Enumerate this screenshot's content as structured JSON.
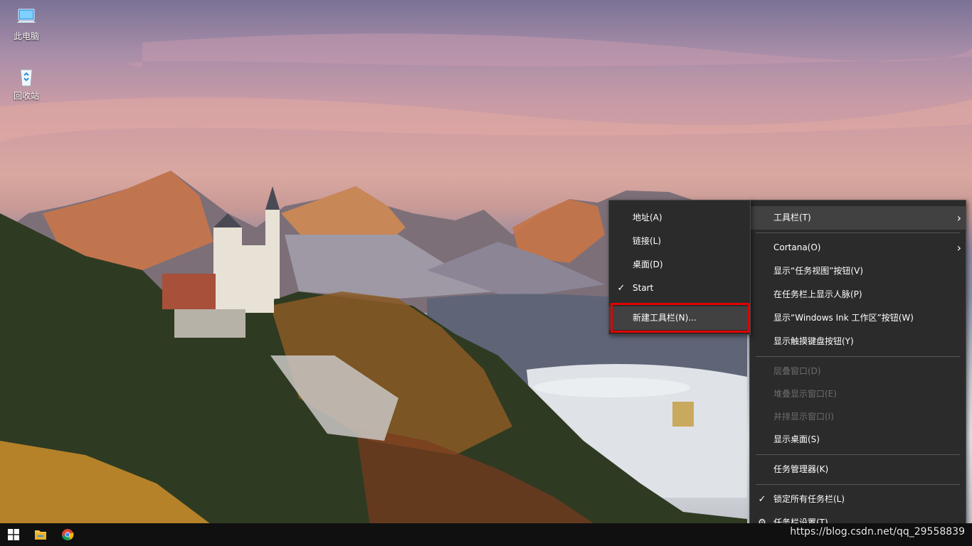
{
  "desktop": {
    "icons": [
      {
        "label": "此电脑"
      },
      {
        "label": "回收站"
      }
    ]
  },
  "context_menu": {
    "items": [
      {
        "label": "工具栏(T)",
        "has_submenu": true
      },
      {
        "label": "Cortana(O)",
        "has_submenu": true
      },
      {
        "label": "显示“任务视图”按钮(V)"
      },
      {
        "label": "在任务栏上显示人脉(P)"
      },
      {
        "label": "显示“Windows Ink 工作区”按钮(W)"
      },
      {
        "label": "显示触摸键盘按钮(Y)"
      },
      {
        "label": "层叠窗口(D)",
        "disabled": true
      },
      {
        "label": "堆叠显示窗口(E)",
        "disabled": true
      },
      {
        "label": "并排显示窗口(I)",
        "disabled": true
      },
      {
        "label": "显示桌面(S)"
      },
      {
        "label": "任务管理器(K)"
      },
      {
        "label": "锁定所有任务栏(L)",
        "checked": true
      },
      {
        "label": "任务栏设置(T)",
        "icon": "gear-icon"
      }
    ]
  },
  "toolbar_submenu": {
    "items": [
      {
        "label": "地址(A)"
      },
      {
        "label": "链接(L)"
      },
      {
        "label": "桌面(D)"
      },
      {
        "label": "Start",
        "checked": true
      },
      {
        "label": "新建工具栏(N)..."
      }
    ]
  },
  "taskbar": {
    "icons": [
      "windows-start-icon",
      "file-explorer-icon",
      "chrome-icon"
    ]
  },
  "watermark": "https://blog.csdn.net/qq_29558839",
  "colors": {
    "menu_bg": "#2b2b2b",
    "menu_highlight": "#414141",
    "disabled_text": "#6d6d6d",
    "annotation_red": "#e00000",
    "taskbar_bg": "#101010"
  }
}
